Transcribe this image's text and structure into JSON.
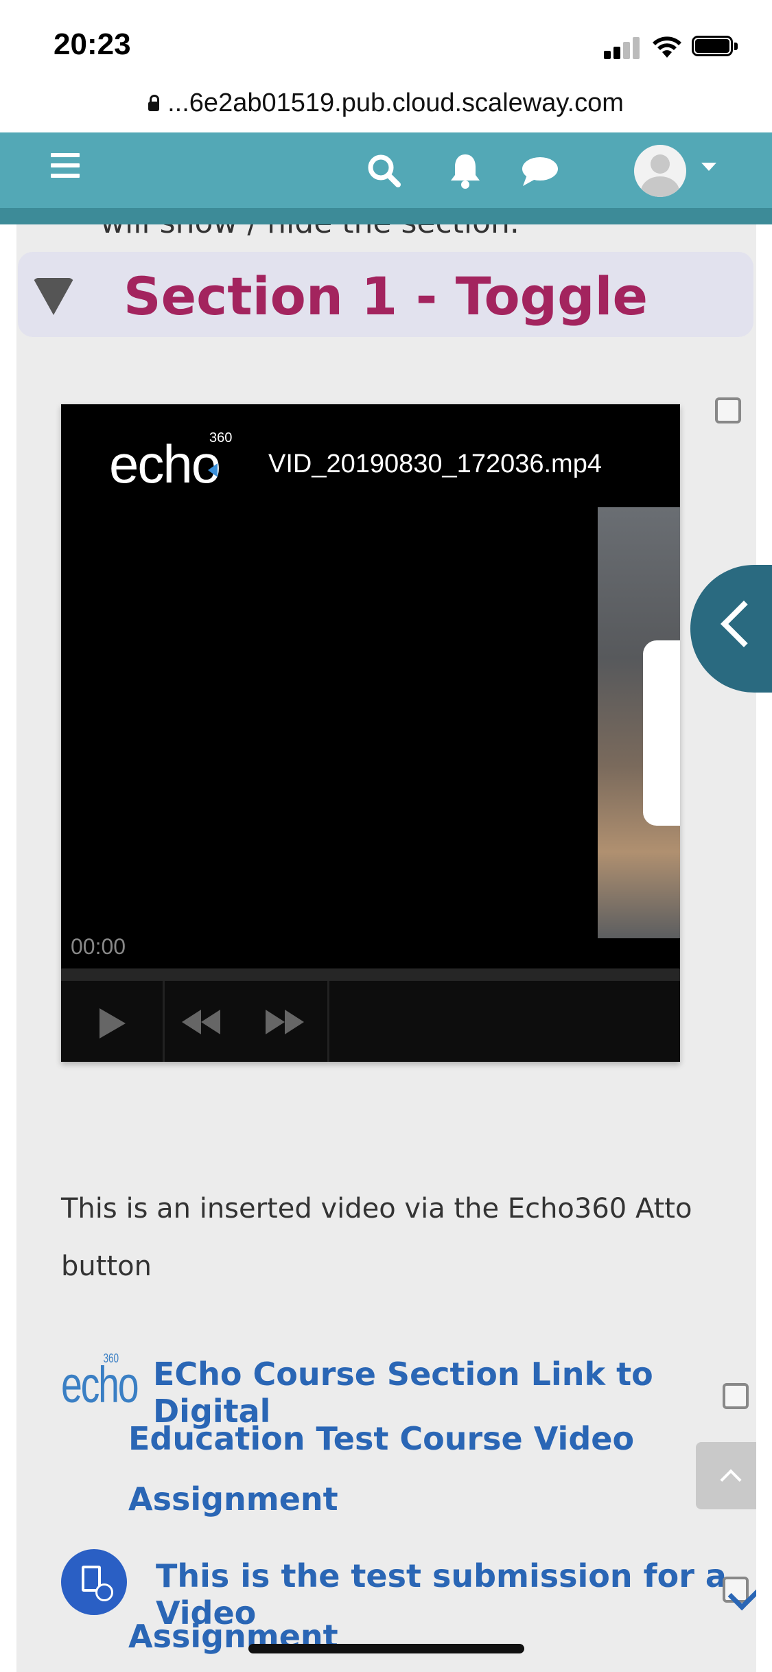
{
  "status_bar": {
    "time": "20:23"
  },
  "browser": {
    "url": "...6e2ab01519.pub.cloud.scaleway.com"
  },
  "navbar": {
    "icons": [
      "hamburger-menu-icon",
      "search-icon",
      "bell-icon",
      "chat-icon",
      "avatar",
      "caret-down-icon"
    ],
    "accent_color": "#53a8b6"
  },
  "content": {
    "cut_text": "will show / hide the section.",
    "section": {
      "title": "Section 1 - Toggle",
      "title_color": "#a3245e"
    },
    "video": {
      "brand": "echo",
      "brand_sup": "360",
      "title": "VID_20190830_172036.mp4",
      "time": "00:00"
    },
    "description": "This is an inserted video via the Echo360 Atto button",
    "activity1": {
      "icon_text": "echo",
      "icon_sup": "360",
      "line1": "ECho Course Section Link to Digital",
      "line2": "Education Test Course Video",
      "line3": "Assignment"
    },
    "activity2": {
      "line1": "This is the test submission for a Video",
      "line2": "Assignment"
    },
    "link_color": "#2a66b5"
  }
}
